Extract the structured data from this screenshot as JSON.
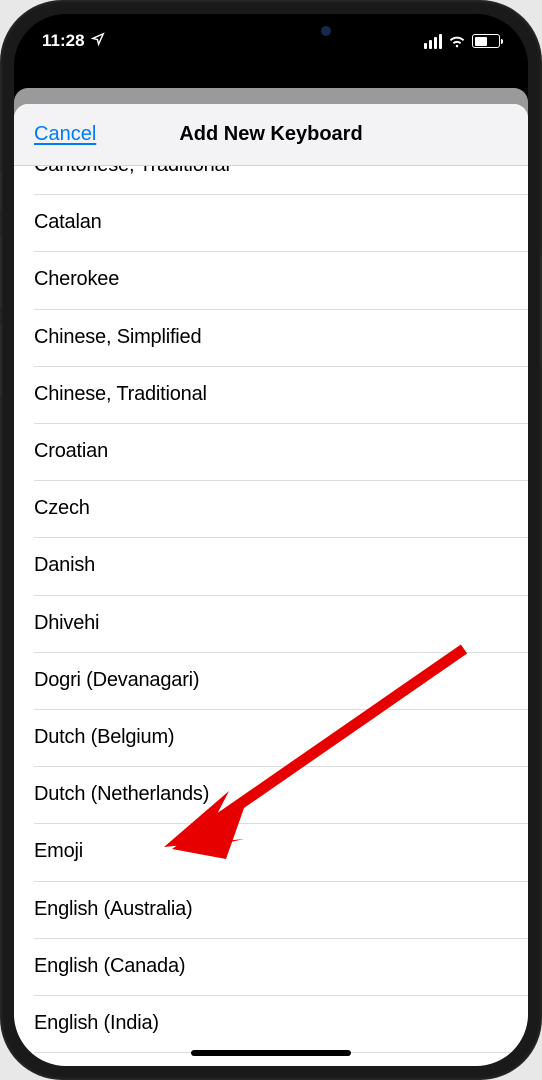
{
  "status": {
    "time": "11:28"
  },
  "nav": {
    "cancel": "Cancel",
    "title": "Add New Keyboard"
  },
  "keyboards": [
    "Cantonese, Traditional",
    "Catalan",
    "Cherokee",
    "Chinese, Simplified",
    "Chinese, Traditional",
    "Croatian",
    "Czech",
    "Danish",
    "Dhivehi",
    "Dogri (Devanagari)",
    "Dutch (Belgium)",
    "Dutch (Netherlands)",
    "Emoji",
    "English (Australia)",
    "English (Canada)",
    "English (India)"
  ]
}
